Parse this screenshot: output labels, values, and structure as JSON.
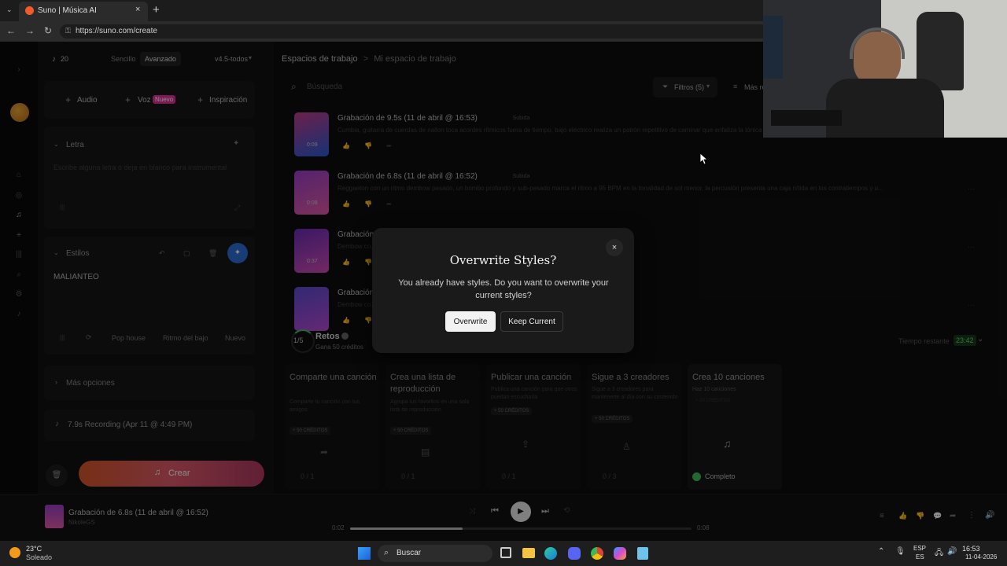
{
  "browser": {
    "tab_title": "Suno | Música AI",
    "new_tab": "+",
    "url": "https://suno.com/create"
  },
  "left": {
    "credits": "20",
    "mode_simple": "Sencillo",
    "mode_advanced": "Avanzado",
    "model": "v4.5-todos",
    "audio_btn": "Audio",
    "voz_btn": "Voz",
    "voz_badge": "Nuevo",
    "inspiracion_btn": "Inspiración",
    "lyrics_label": "Letra",
    "lyrics_placeholder": "Escribe alguna letra o deja en blanco para instrumental",
    "styles_label": "Estilos",
    "styles_value": "MALIANTEO",
    "style_chips": [
      "Pop house",
      "Ritmo del bajo",
      "Nuevo"
    ],
    "more_options": "Más opciones",
    "recording": "7.9s Recording (Apr 11 @ 4:49 PM)",
    "create_btn": "Crear"
  },
  "main": {
    "breadcrumb_root": "Espacios de trabajo",
    "breadcrumb_sep": ">",
    "breadcrumb_current": "Mi espacio de trabajo",
    "search_placeholder": "Búsqueda",
    "filters": "Filtros (5)",
    "more": "Más re",
    "songs": [
      {
        "title": "Grabación de 9.5s (11 de abril @ 16:53)",
        "tag": "Subida",
        "desc": "Cumbia, guitarra de cuerdas de nailon toca acordes rítmicos fuera de tiempo, bajo eléctrico realiza un patrón repetitivo de caminar que enfatiza la tónica y qui",
        "duration": "0:09",
        "colors": [
          "#c23b8a",
          "#2a5bd6"
        ]
      },
      {
        "title": "Grabación de 6.8s (11 de abril @ 16:52)",
        "tag": "Subida",
        "desc": "Reggaeton con un ritmo dembow pesado, un bombo profundo y sub-pesado marca el ritmo a 95 BPM en la tonalidad de sol menor, la percusión presenta una caja nítida en los contratiempos y u...",
        "duration": "0:08",
        "colors": [
          "#9b3fc9",
          "#e35aa8"
        ]
      },
      {
        "title": "Grabación d",
        "tag": "",
        "desc": "Dembow co... ritmo sincopado de tambor dembow 3-3-2 con un bombo pesado y contundente y o...",
        "duration": "0:37",
        "colors": [
          "#6a2db8",
          "#d04bb5"
        ]
      },
      {
        "title": "Grabación",
        "tag": "",
        "desc": "Dembow co... ritmo sincopado de tambor dembow 3-3-2 con un bombo pesado y contundente y o...",
        "duration": "",
        "colors": [
          "#5a4bd0",
          "#b84ad6"
        ]
      }
    ],
    "challenges": {
      "progress": "1/5",
      "title": "Retos",
      "subtitle": "Gana 50 créditos",
      "time_label": "Tiempo restante",
      "time_value": "23:42",
      "cards": [
        {
          "title": "Comparte una canción",
          "desc": "Comparte tu canción con tus amigos",
          "badge": "+ 50 CRÉDITOS",
          "progress": "0 / 1"
        },
        {
          "title": "Crea una lista de reproducción",
          "desc": "Agrupa tus favoritos en una sola lista de reproducción",
          "badge": "+ 50 CRÉDITOS",
          "progress": "0 / 1"
        },
        {
          "title": "Publicar una canción",
          "desc": "Publica una canción para que otros puedan escucharla",
          "badge": "+ 50 CRÉDITOS",
          "progress": "0 / 1"
        },
        {
          "title": "Sigue a 3 creadores",
          "desc": "Sigue a 3 creadores para mantenerte al día con su contenido",
          "badge": "+ 50 CRÉDITOS",
          "progress": "0 / 3"
        },
        {
          "title": "Crea 10 canciones",
          "desc": "Haz 10 canciones",
          "badge": "+ 50 CRÉDITOS",
          "progress": "Completo"
        }
      ]
    }
  },
  "modal": {
    "title": "Overwrite Styles?",
    "message": "You already have styles. Do you want to overwrite your current styles?",
    "confirm": "Overwrite",
    "cancel": "Keep Current",
    "close": "×"
  },
  "player": {
    "title": "Grabación de 6.8s (11 de abril @ 16:52)",
    "artist": "NikoleGS",
    "time_current": "0:02",
    "time_total": "0:08",
    "progress": 0.33
  },
  "taskbar": {
    "temp": "23°C",
    "weather": "Soleado",
    "search": "Buscar",
    "lang": "ESP",
    "lang_sub": "ES",
    "time": "16:53",
    "date": "11-04-2026"
  }
}
